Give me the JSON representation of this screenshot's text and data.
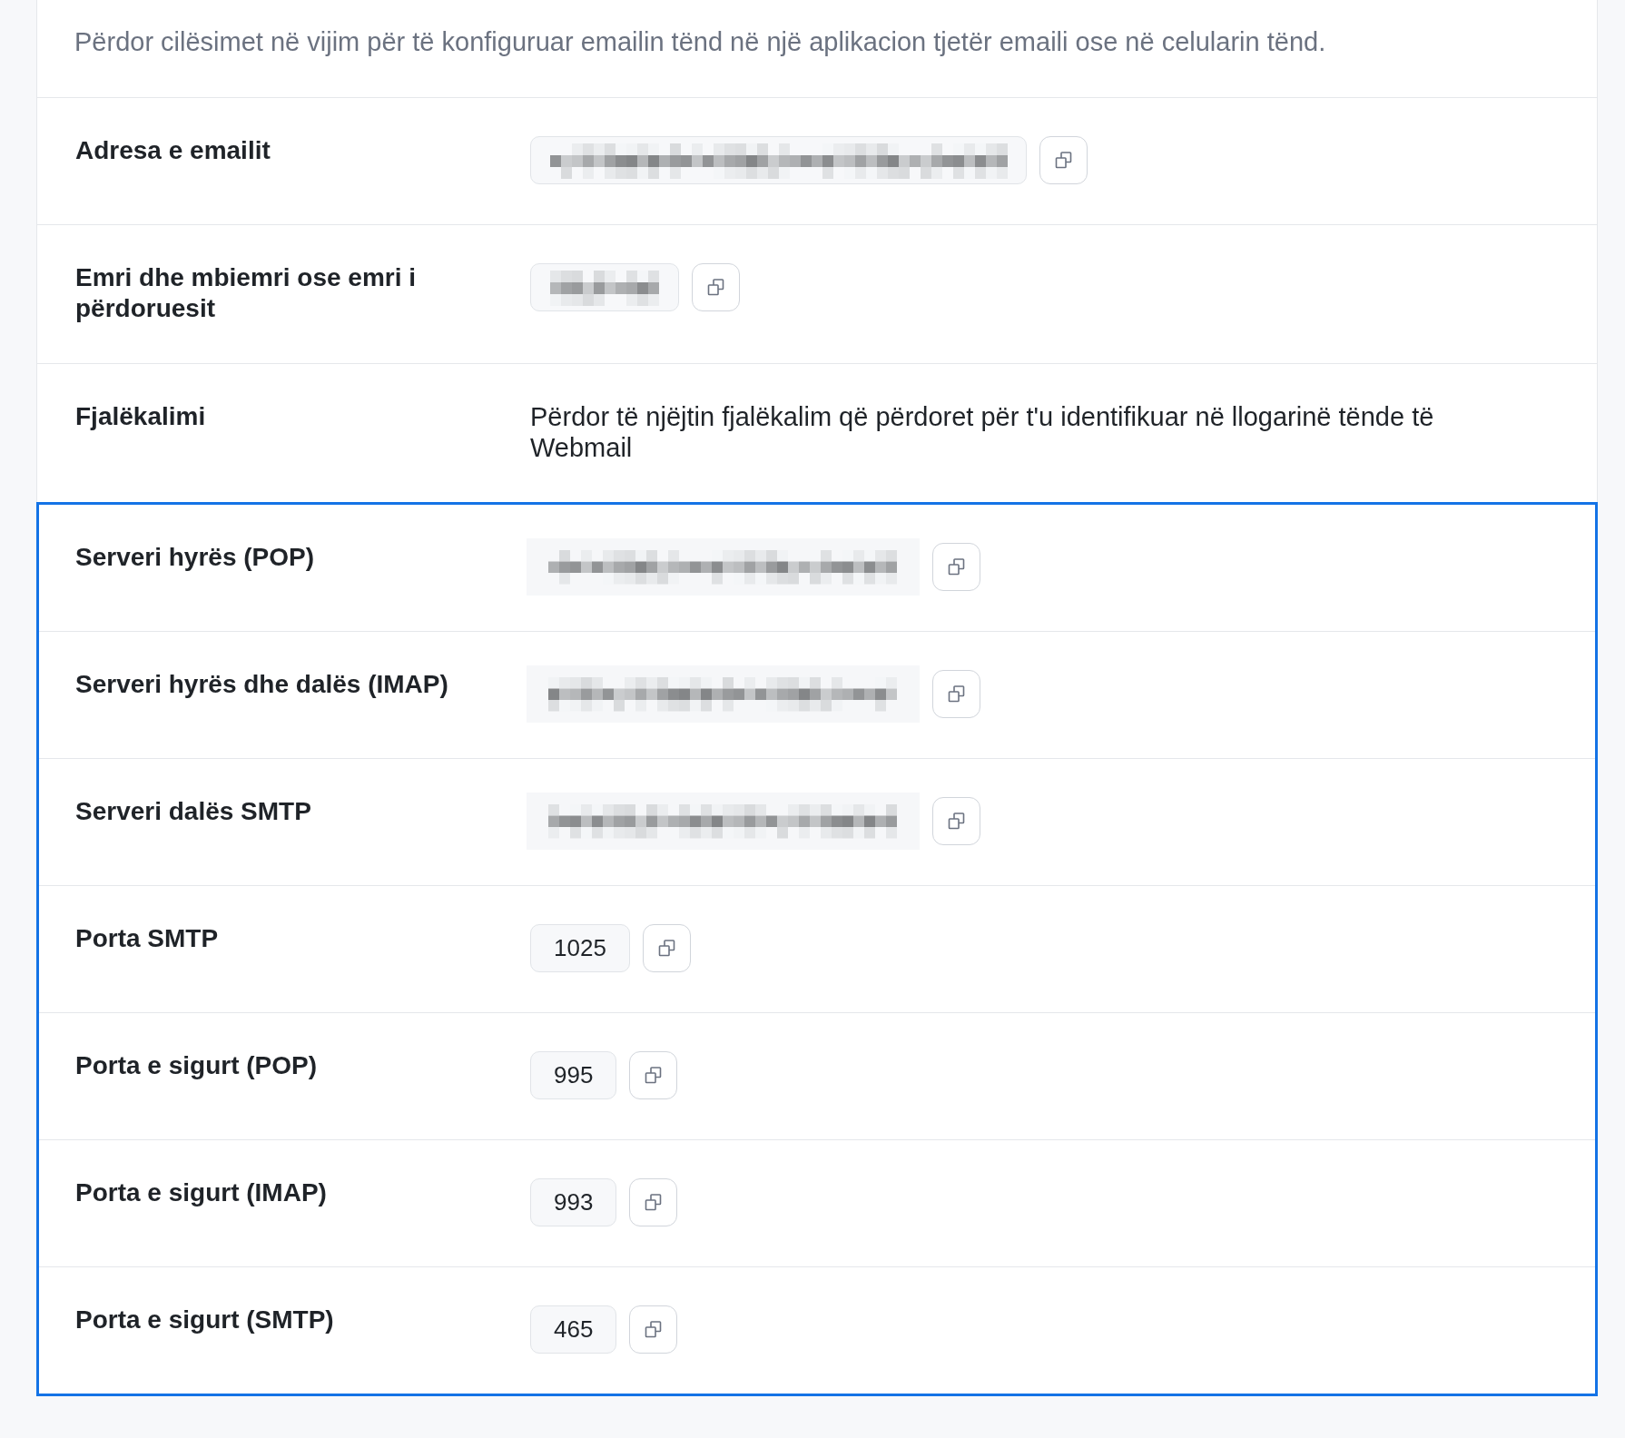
{
  "description": "Përdor cilësimet në vijim për të konfiguruar emailin tënd në një aplikacion tjetër emaili ose në celularin tënd.",
  "groups": [
    {
      "highlighted": false,
      "rows": [
        {
          "label": "Adresa e emailit",
          "kind": "masked_wide"
        },
        {
          "label": "Emri dhe mbiemri ose emri i përdoruesit",
          "kind": "masked_narrow"
        },
        {
          "label": "Fjalëkalimi",
          "kind": "text",
          "value": "Përdor të njëjtin fjalëkalim që përdoret për t'u identifikuar në llogarinë tënde të Webmail"
        }
      ]
    },
    {
      "highlighted": true,
      "rows": [
        {
          "label": "Serveri hyrës (POP)",
          "kind": "masked_plain"
        },
        {
          "label": "Serveri hyrës dhe dalës (IMAP)",
          "kind": "masked_plain"
        },
        {
          "label": "Serveri dalës SMTP",
          "kind": "masked_plain"
        },
        {
          "label": "Porta SMTP",
          "kind": "value",
          "value": "1025"
        },
        {
          "label": "Porta e sigurt (POP)",
          "kind": "value",
          "value": "995"
        },
        {
          "label": "Porta e sigurt (IMAP)",
          "kind": "value",
          "value": "993"
        },
        {
          "label": "Porta e sigurt (SMTP)",
          "kind": "value",
          "value": "465"
        }
      ]
    }
  ]
}
